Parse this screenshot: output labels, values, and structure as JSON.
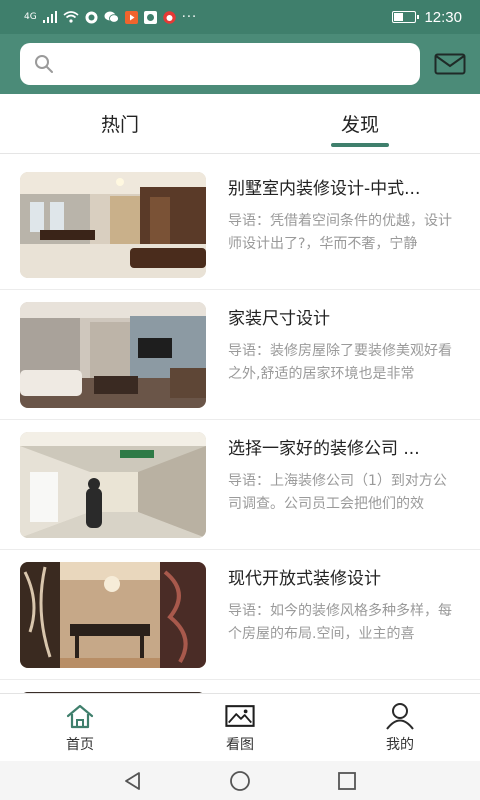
{
  "status_bar": {
    "signal_text": "4G",
    "time": "12:30"
  },
  "search": {
    "placeholder": ""
  },
  "tabs": [
    {
      "label": "热门",
      "active": false
    },
    {
      "label": "发现",
      "active": true
    }
  ],
  "articles": [
    {
      "title": "别墅室内装修设计-中式...",
      "desc": "导语：凭借着空间条件的优越，设计师设计出了?，华而不奢，宁静"
    },
    {
      "title": "家装尺寸设计",
      "desc": "导语：装修房屋除了要装修美观好看之外,舒适的居家环境也是非常"
    },
    {
      "title": "选择一家好的装修公司 ...",
      "desc": "导语：上海装修公司（1）到对方公司调查。公司员工会把他们的效"
    },
    {
      "title": "现代开放式装修设计",
      "desc": "导语：如今的装修风格多种多样，每个房屋的布局.空间，业主的喜"
    }
  ],
  "bottom_nav": [
    {
      "label": "首页",
      "icon": "home-icon",
      "active": true
    },
    {
      "label": "看图",
      "icon": "image-icon",
      "active": false
    },
    {
      "label": "我的",
      "icon": "user-icon",
      "active": false
    }
  ],
  "colors": {
    "brand": "#3f7f6c",
    "header": "#4b8b78",
    "desc_text": "#9a9a9a"
  }
}
